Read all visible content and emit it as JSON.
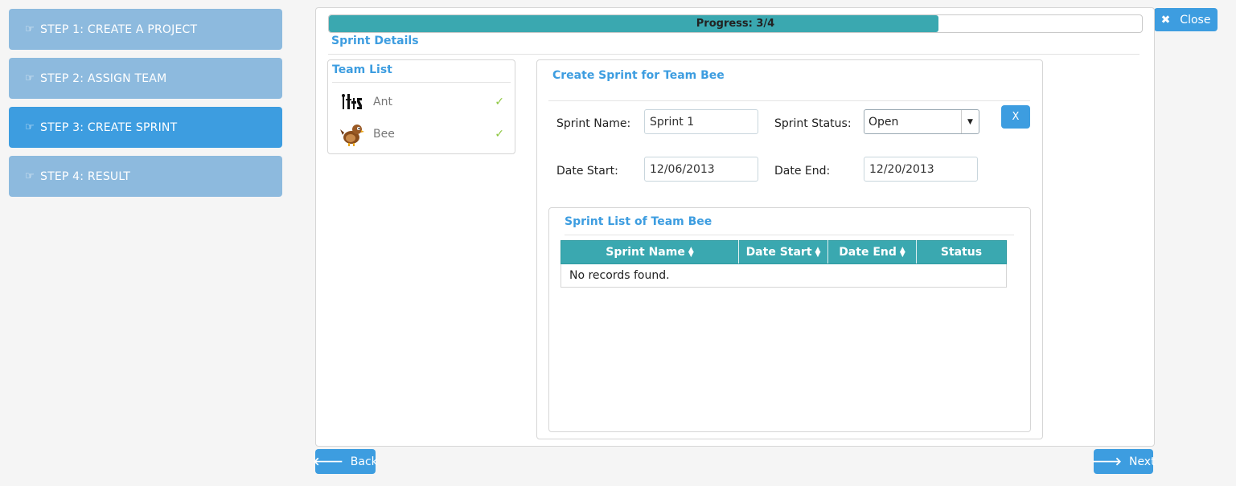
{
  "steps": [
    {
      "label": "STEP 1: CREATE A PROJECT",
      "active": false
    },
    {
      "label": "STEP 2: ASSIGN TEAM",
      "active": false
    },
    {
      "label": "STEP 3: CREATE SPRINT",
      "active": true
    },
    {
      "label": "STEP 4: RESULT",
      "active": false
    }
  ],
  "close_button": {
    "label": "Close",
    "icon": "close-icon"
  },
  "progress": {
    "label": "Progress: 3/4",
    "value": 0.75
  },
  "section_title": "Sprint Details",
  "team_list": {
    "title": "Team List",
    "teams": [
      {
        "name": "Ant",
        "avatar": "ant-avatar",
        "check": "✓"
      },
      {
        "name": "Bee",
        "avatar": "bee-avatar",
        "check": "✓"
      }
    ]
  },
  "create_sprint": {
    "title": "Create Sprint for Team Bee",
    "sprint_name_label": "Sprint Name:",
    "sprint_name_value": "Sprint 1",
    "sprint_status_label": "Sprint Status:",
    "sprint_status_value": "Open",
    "date_start_label": "Date Start:",
    "date_start_value": "12/06/2013",
    "date_end_label": "Date End:",
    "date_end_value": "12/20/2013",
    "clear_button": "X"
  },
  "sprint_list": {
    "title": "Sprint List of Team Bee",
    "columns": [
      "Sprint Name",
      "Date Start",
      "Date End",
      "Status"
    ],
    "empty_message": "No records found."
  },
  "nav": {
    "back_label": "Back",
    "next_label": "Next"
  },
  "colors": {
    "accent": "#3d9de0",
    "step_inactive": "#8dbade",
    "table_header": "#3aa8b0",
    "check": "#8cc63e"
  }
}
